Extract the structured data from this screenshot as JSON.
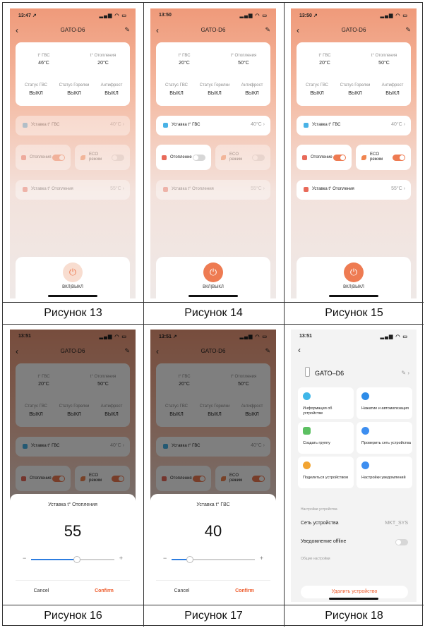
{
  "captions": [
    "Рисунок 13",
    "Рисунок 14",
    "Рисунок 15",
    "Рисунок 16",
    "Рисунок 17",
    "Рисунок 18"
  ],
  "accent_color": "#ee7b52",
  "icons": {
    "back": "chevron-left-icon",
    "edit": "pencil-icon",
    "power": "power-icon",
    "more": "chevron-right-icon"
  },
  "screens": [
    {
      "time": "13:47 ↗",
      "title": "GATO-D6",
      "ghw_lbl": "t° ГВС",
      "ghw": "46°C",
      "heat_lbl": "t° Отопления",
      "heat": "20°C",
      "st_ghw_lbl": "Статус ГВС",
      "st_ghw": "ВЫКЛ",
      "st_burn_lbl": "Статус Горелки",
      "st_burn": "ВЫКЛ",
      "anti_lbl": "Антифрост",
      "anti": "ВЫКЛ",
      "set_ghw": "Уставка t° ГВС",
      "set_ghw_val": "40°C",
      "heating": "Отопления",
      "eco": "ECO режим",
      "set_heat": "Уставка t° Отопления",
      "set_heat_val": "55°C",
      "power": "ВКЛ|ВЫКЛ"
    },
    {
      "time": "13:50",
      "title": "GATO-D6",
      "ghw_lbl": "t° ГВС",
      "ghw": "20°C",
      "heat_lbl": "t° Отопления",
      "heat": "50°C",
      "st_ghw_lbl": "Статус ГВС",
      "st_ghw": "ВЫКЛ",
      "st_burn_lbl": "Статус Горелки",
      "st_burn": "ВЫКЛ",
      "anti_lbl": "Антифрост",
      "anti": "ВЫКЛ",
      "set_ghw": "Уставка t° ГВС",
      "set_ghw_val": "40°C",
      "heating": "Отопление",
      "eco": "ECO режим",
      "set_heat": "Уставка t° Отопления",
      "set_heat_val": "55°C",
      "power": "ВКЛ|ВЫКЛ"
    },
    {
      "time": "13:50 ↗",
      "title": "GATO-D6",
      "ghw_lbl": "t° ГВС",
      "ghw": "20°C",
      "heat_lbl": "t° Отопления",
      "heat": "50°C",
      "st_ghw_lbl": "Статус ГВС",
      "st_ghw": "ВЫКЛ",
      "st_burn_lbl": "Статус Горелки",
      "st_burn": "ВЫКЛ",
      "anti_lbl": "Антифрост",
      "anti": "ВЫКЛ",
      "set_ghw": "Уставка t° ГВС",
      "set_ghw_val": "40°C",
      "heating": "Отопление",
      "eco": "ECO режим",
      "set_heat": "Уставка t° Отопления",
      "set_heat_val": "55°C",
      "power": "ВКЛ|ВЫКЛ"
    },
    {
      "time": "13:51",
      "title": "GATO-D6",
      "ghw_lbl": "t° ГВС",
      "ghw": "20°C",
      "heat_lbl": "t° Отопления",
      "heat": "50°C",
      "st_ghw_lbl": "Статус ГВС",
      "st_ghw": "ВЫКЛ",
      "st_burn_lbl": "Статус Горелки",
      "st_burn": "ВЫКЛ",
      "anti_lbl": "Антифрост",
      "anti": "ВЫКЛ",
      "set_ghw": "Уставка t° ГВС",
      "set_ghw_val": "40°C",
      "heating": "Отопления",
      "eco": "ECO режим",
      "sheet_title": "Уставка t° Отопления",
      "sheet_value": "55",
      "slider_fraction": 0.55,
      "cancel": "Cancel",
      "confirm": "Confirm"
    },
    {
      "time": "13:51 ↗",
      "title": "GATO-D6",
      "ghw_lbl": "t° ГВС",
      "ghw": "20°C",
      "heat_lbl": "t° Отопления",
      "heat": "50°C",
      "st_ghw_lbl": "Статус ГВС",
      "st_ghw": "ВЫКЛ",
      "st_burn_lbl": "Статус Горелки",
      "st_burn": "ВЫКЛ",
      "anti_lbl": "Антифрост",
      "anti": "ВЫКЛ",
      "set_ghw": "Уставка t° ГВС",
      "set_ghw_val": "40°C",
      "heating": "Отопления",
      "eco": "ECO режим",
      "sheet_title": "Уставка t° ГВС",
      "sheet_value": "40",
      "slider_fraction": 0.22,
      "cancel": "Cancel",
      "confirm": "Confirm"
    },
    {
      "time": "13:51",
      "device": "GATO–D6",
      "tiles": [
        "Информация об устройстве",
        "Нажатие и автоматизация",
        "Создать группу",
        "Проверить сеть устройства",
        "Поделиться устройством",
        "Настройки уведомлений"
      ],
      "section1": "Настройки устройства",
      "network": "Сеть устройства",
      "network_val": "MKT_SYS",
      "offline": "Уведомление offline",
      "section2": "Общие настройки",
      "delete": "Удалить устройство"
    }
  ]
}
